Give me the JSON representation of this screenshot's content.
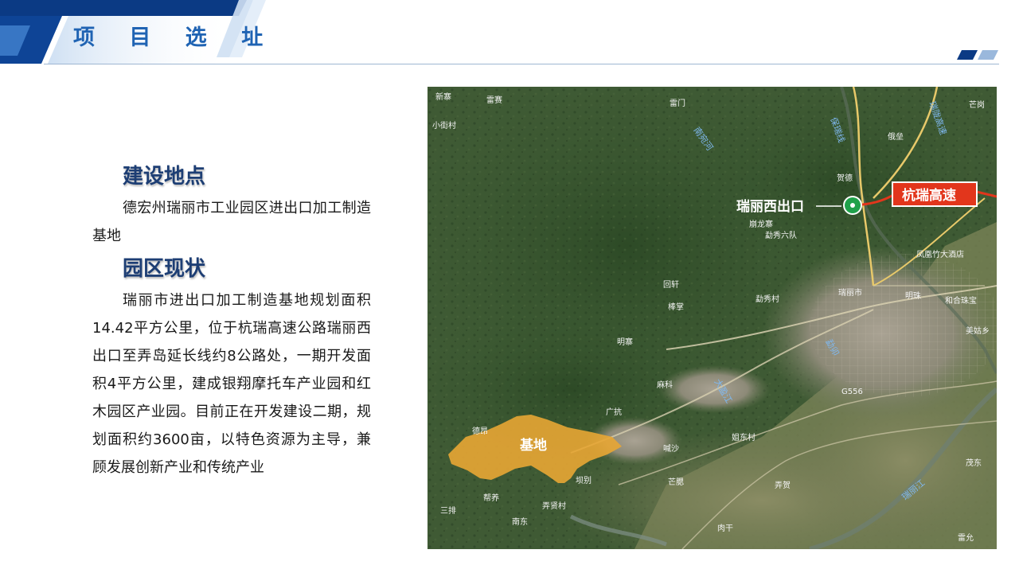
{
  "header": {
    "title": "项 目 选 址"
  },
  "sections": [
    {
      "heading": "建设地点",
      "body": "德宏州瑞丽市工业园区进出口加工制造基地"
    },
    {
      "heading": "园区现状",
      "body": "瑞丽市进出口加工制造基地规划面积14.42平方公里，位于杭瑞高速公路瑞丽西出口至弄岛延长线约8公路处，一期开发面积4平方公里，建成银翔摩托车产业园和红木园区产业园。目前正在开发建设二期，规划面积约3600亩，以特色资源为主导，兼顾发展创新产业和传统产业"
    }
  ],
  "map": {
    "callouts": {
      "exit_label": "瑞丽西出口",
      "highway_label": "杭瑞高速",
      "base_label": "基地"
    },
    "place_labels": {
      "xinzhai": "新寨",
      "leisai": "雷赛",
      "xiaojie": "小街村",
      "leimen": "雷门",
      "hede": "贺德",
      "jiexiu": "俄垒",
      "manglong": "崩龙寨",
      "qixiu": "勐秀六队",
      "fenghuang": "凤凰竹大酒店",
      "ruili_city": "瑞丽市",
      "huixuan": "回轩",
      "qiaozhang": "棒掌",
      "mengxiu_cun": "勐秀村",
      "mingzhai": "明寨",
      "mali": "麻科",
      "guangkang": "广抗",
      "debao": "德昂",
      "hansha": "喊沙",
      "jiedong": "姐东村",
      "mangpi": "芒腮",
      "nongdao": "弄贤村",
      "nandong": "南东",
      "sanpai": "三排",
      "leiyang": "帮养",
      "xianbie": "坝别",
      "nongfu": "弄贺",
      "maodong": "茂东",
      "rougan": "肉干",
      "leiyao": "雷允",
      "mangxin": "芒岗",
      "tonghe": "和合珠宝",
      "meigu": "美姑乡",
      "mingzhu": "明珠",
      "g56": "G556",
      "baorui": "保瑞线",
      "ruilong": "瑞陇高速",
      "nanwan": "南宛河",
      "daying": "大盈江",
      "ruili_river": "瑞丽江",
      "mengmao": "勐卯"
    }
  },
  "colors": {
    "title": "#1f63b3",
    "heading": "#1d3e74",
    "accent_dark": "#0b3a84",
    "accent_light": "#6ea3dc",
    "highway_red": "#e2361c",
    "exit_green": "#1fa14a",
    "base_orange": "#e8a634"
  },
  "icons": {
    "header_stripes": "diagonal-stripe-banner",
    "corner_tabs": "parallelogram-pair",
    "exit_marker": "green-circle-dot"
  }
}
